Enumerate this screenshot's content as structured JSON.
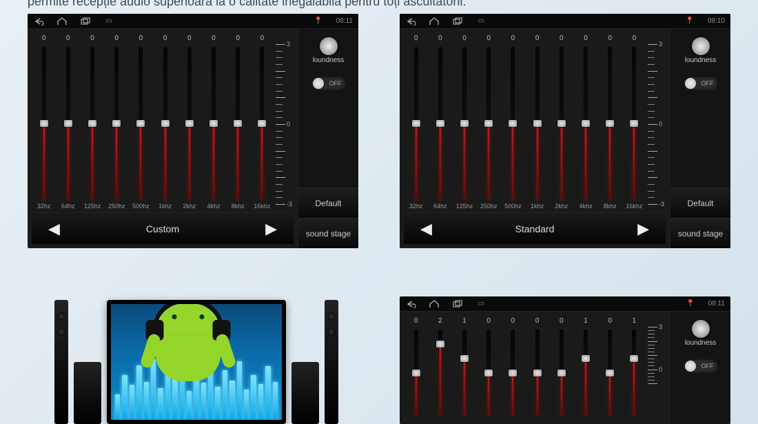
{
  "caption": "permite recepție audio superioară la o calitate inegalabilă pentru toți ascultătorii.",
  "scale": {
    "max": 3,
    "min": -3,
    "labels": [
      "3",
      "0",
      "-3"
    ]
  },
  "freq_labels": [
    "32hz",
    "64hz",
    "125hz",
    "250hz",
    "500hz",
    "1khz",
    "2khz",
    "4khz",
    "8khz",
    "16khz"
  ],
  "side": {
    "loudness_label": "loundness",
    "toggle_label": "OFF",
    "default_btn": "Default",
    "soundstage_btn": "sound stage"
  },
  "panels": [
    {
      "time": "08:11",
      "preset": "Custom",
      "values": [
        0,
        0,
        0,
        0,
        0,
        0,
        0,
        0,
        0,
        0
      ]
    },
    {
      "time": "08:10",
      "preset": "Standard",
      "values": [
        0,
        0,
        0,
        0,
        0,
        0,
        0,
        0,
        0,
        0
      ]
    },
    {
      "time": "08:11",
      "preset": "",
      "values": [
        0,
        2,
        1,
        0,
        0,
        0,
        0,
        1,
        0,
        1
      ],
      "partial": true
    }
  ],
  "image_block": {
    "description": "Android mascot wearing headphones with audio visualizer, flanked by speakers"
  },
  "tv_bar_heights": [
    40,
    70,
    55,
    85,
    60,
    95,
    50,
    80,
    65,
    90,
    45,
    75,
    58,
    88,
    52,
    78,
    62,
    92,
    48,
    70,
    56,
    84,
    60
  ]
}
